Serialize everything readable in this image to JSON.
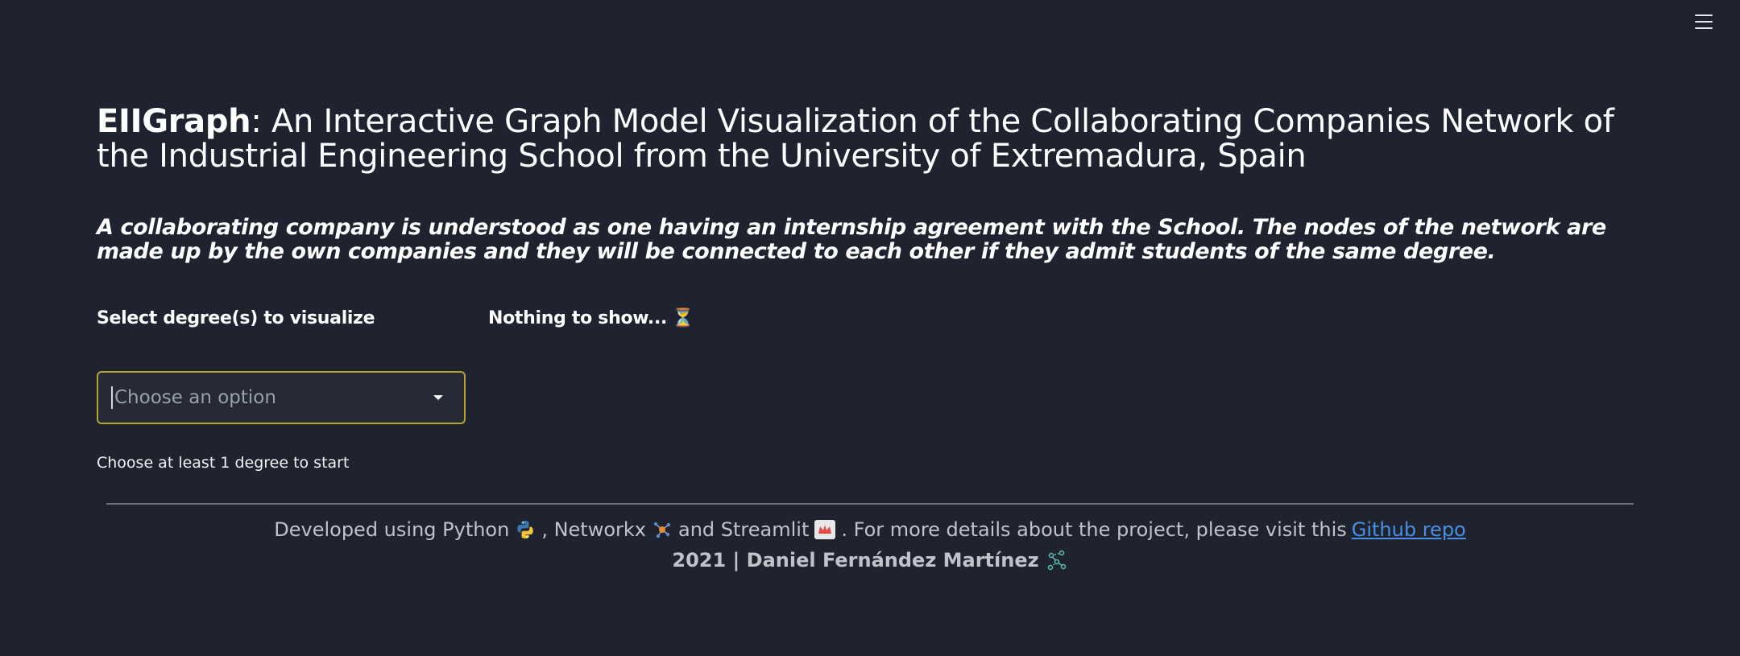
{
  "header": {
    "menu_icon": "hamburger-menu-icon"
  },
  "title": {
    "bold": "EIIGraph",
    "rest": ": An Interactive Graph Model Visualization of the Collaborating Companies Network of the Industrial Engineering School from the University of Extremadura, Spain"
  },
  "subtitle": {
    "part1": "A collaborating company is understood as one having an ",
    "bold": "internship",
    "part2": " agreement with the School. The nodes of the network are made up by the own companies and they will be connected to each other if they admit students of the same degree."
  },
  "controls": {
    "select_label": "Select degree(s) to visualize",
    "select_placeholder": "Choose an option",
    "hint": "Choose at least 1 degree to start"
  },
  "status": {
    "text": "Nothing to show...",
    "icon": "hourglass-icon"
  },
  "footer": {
    "developed_using": "Developed using Python",
    "networkx": ", Networkx",
    "and_streamlit": "and Streamlit",
    "more_details": ". For more details about the project, please visit this",
    "link_text": "Github repo",
    "credit": "2021 | Daniel Fernández Martínez",
    "icons": [
      "python-icon",
      "networkx-icon",
      "streamlit-icon",
      "graph-icon"
    ]
  },
  "colors": {
    "background": "#1f2330",
    "select_border": "#b5a230",
    "link": "#4a90e2"
  }
}
